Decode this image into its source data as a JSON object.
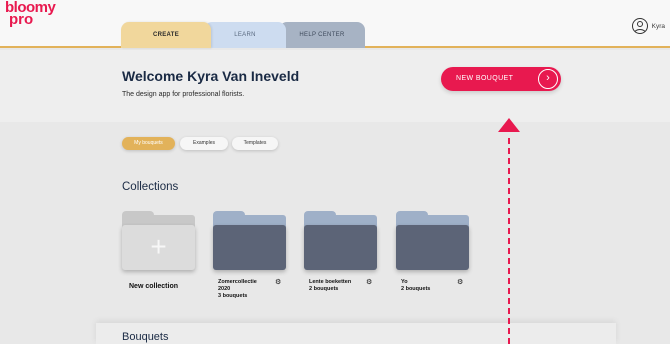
{
  "brand": {
    "line1": "bloomy",
    "line2": "pro"
  },
  "tabs": [
    {
      "label": "CREATE"
    },
    {
      "label": "LEARN"
    },
    {
      "label": "HELP CENTER"
    }
  ],
  "user": {
    "name": "Kyra",
    "icon": "user-icon"
  },
  "hero": {
    "title": "Welcome Kyra Van Ineveld",
    "subtitle": "The design app for professional florists.",
    "new_bouquet_label": "NEW BOUQUET",
    "new_bouquet_icon": "chevron-right-icon"
  },
  "filters": [
    {
      "label": "My bouquets",
      "active": true
    },
    {
      "label": "Examples",
      "active": false
    },
    {
      "label": "Templates",
      "active": false
    }
  ],
  "collections": {
    "heading": "Collections",
    "new_label": "New collection",
    "items": [
      {
        "name": "Zomercollectie 2020",
        "count": "3 bouquets"
      },
      {
        "name": "Lente boeketten",
        "count": "2 bouquets"
      },
      {
        "name": "Yo",
        "count": "2 bouquets"
      }
    ]
  },
  "bouquets": {
    "heading": "Bouquets"
  },
  "colors": {
    "accent": "#e8194f",
    "gold": "#e2b25a",
    "folder_dark": "#5c6477",
    "folder_light": "#9fb0c8"
  }
}
